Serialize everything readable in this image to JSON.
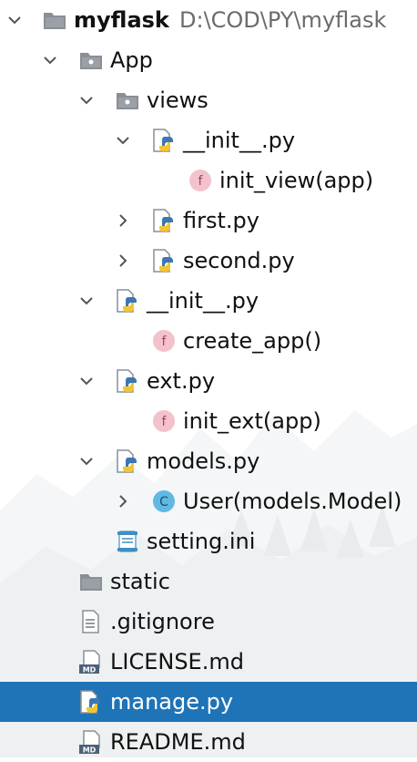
{
  "tree": {
    "root": {
      "name": "myflask",
      "path": "D:\\COD\\PY\\myflask",
      "icon": "folder-icon"
    },
    "rows": [
      {
        "id": "app",
        "label": "App",
        "icon": "folder-icon",
        "chevron": "expanded"
      },
      {
        "id": "views",
        "label": "views",
        "icon": "folder-icon",
        "chevron": "expanded"
      },
      {
        "id": "views-init",
        "label": "__init__.py",
        "icon": "python-file-icon",
        "chevron": "expanded"
      },
      {
        "id": "init-view",
        "label": "init_view(app)",
        "icon": "function-icon",
        "chevron": "none"
      },
      {
        "id": "first",
        "label": "first.py",
        "icon": "python-file-icon",
        "chevron": "collapsed"
      },
      {
        "id": "second",
        "label": "second.py",
        "icon": "python-file-icon",
        "chevron": "collapsed"
      },
      {
        "id": "app-init",
        "label": "__init__.py",
        "icon": "python-file-icon",
        "chevron": "expanded"
      },
      {
        "id": "create-app",
        "label": "create_app()",
        "icon": "function-icon",
        "chevron": "none"
      },
      {
        "id": "ext",
        "label": "ext.py",
        "icon": "python-file-icon",
        "chevron": "expanded"
      },
      {
        "id": "init-ext",
        "label": "init_ext(app)",
        "icon": "function-icon",
        "chevron": "none"
      },
      {
        "id": "models",
        "label": "models.py",
        "icon": "python-file-icon",
        "chevron": "expanded"
      },
      {
        "id": "user-class",
        "label": "User(models.Model)",
        "icon": "class-icon",
        "chevron": "collapsed"
      },
      {
        "id": "setting",
        "label": "setting.ini",
        "icon": "ini-file-icon",
        "chevron": "none"
      },
      {
        "id": "static",
        "label": "static",
        "icon": "folder-icon",
        "chevron": "none"
      },
      {
        "id": "gitignore",
        "label": ".gitignore",
        "icon": "text-file-icon",
        "chevron": "none"
      },
      {
        "id": "license",
        "label": "LICENSE.md",
        "icon": "markdown-file-icon",
        "chevron": "none"
      },
      {
        "id": "manage",
        "label": "manage.py",
        "icon": "python-file-icon",
        "chevron": "none",
        "selected": true
      },
      {
        "id": "readme",
        "label": "README.md",
        "icon": "markdown-file-icon",
        "chevron": "none"
      }
    ],
    "badges": {
      "function": "f",
      "class": "C",
      "markdown": "MD"
    },
    "colors": {
      "selection": "#1f74b7",
      "function_badge": "#f3c2cc",
      "class_badge": "#5fb9e3",
      "folder": "#8a8f95",
      "path_text": "#6b6b6b"
    }
  }
}
